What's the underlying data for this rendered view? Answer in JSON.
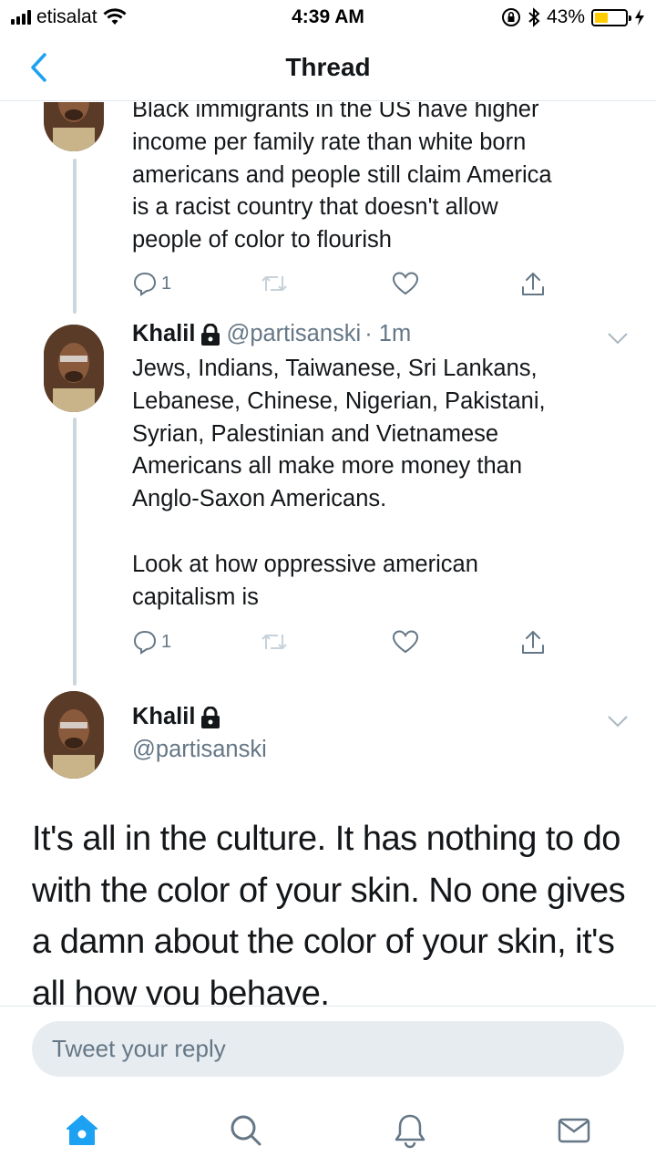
{
  "status_bar": {
    "carrier": "etisalat",
    "time": "4:39 AM",
    "battery": "43%",
    "battery_level": 0.43
  },
  "nav": {
    "title": "Thread"
  },
  "tweets": [
    {
      "text": "Black immigrants in the US have higher\nincome per family rate than white born\namericans and people still claim America\nis a racist country that doesn't allow\npeople of color to flourish",
      "reply_count": "1"
    },
    {
      "name": "Khalil",
      "handle": "@partisanski",
      "time": "· 1m",
      "text": "Jews, Indians, Taiwanese, Sri Lankans,\nLebanese, Chinese, Nigerian, Pakistani,\nSyrian, Palestinian and Vietnamese\nAmericans all make more money than\nAnglo-Saxon Americans.\n\nLook at how oppressive american\ncapitalism is",
      "reply_count": "1"
    },
    {
      "name": "Khalil",
      "handle": "@partisanski",
      "text": "It's all in the culture. It has nothing to do with the color of your skin. No one gives a damn about the color of your skin, it's all how you behave."
    }
  ],
  "reply": {
    "placeholder": "Tweet your reply"
  },
  "tabs": [
    "home-icon",
    "search-icon",
    "notifications-icon",
    "messages-icon"
  ],
  "colors": {
    "accent": "#1da1f2",
    "icon_gray": "#657786",
    "thread_line": "#ccd6dd",
    "battery_fill": "#ffcc00"
  }
}
